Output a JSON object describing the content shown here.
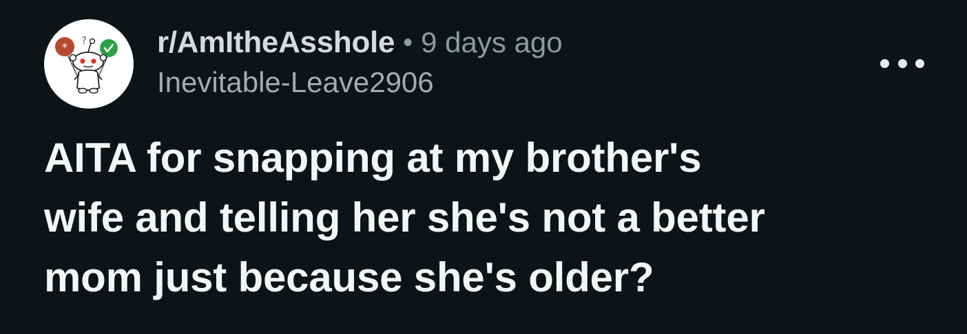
{
  "post": {
    "subreddit": "r/AmItheAsshole",
    "separator": "•",
    "timestamp": "9 days ago",
    "username": "Inevitable-Leave2906",
    "title_lines": [
      "AITA for snapping at my brother's",
      "wife and telling her she's not a better",
      "mom just because she's older?"
    ]
  },
  "icons": {
    "avatar": "snoo-with-balloons-icon",
    "more": "more-options-icon"
  },
  "colors": {
    "background": "#0e1416",
    "title": "#f4f5f6",
    "meta": "#8e9aa0",
    "balloon_left": "#b5482f",
    "balloon_right": "#2ea043"
  }
}
